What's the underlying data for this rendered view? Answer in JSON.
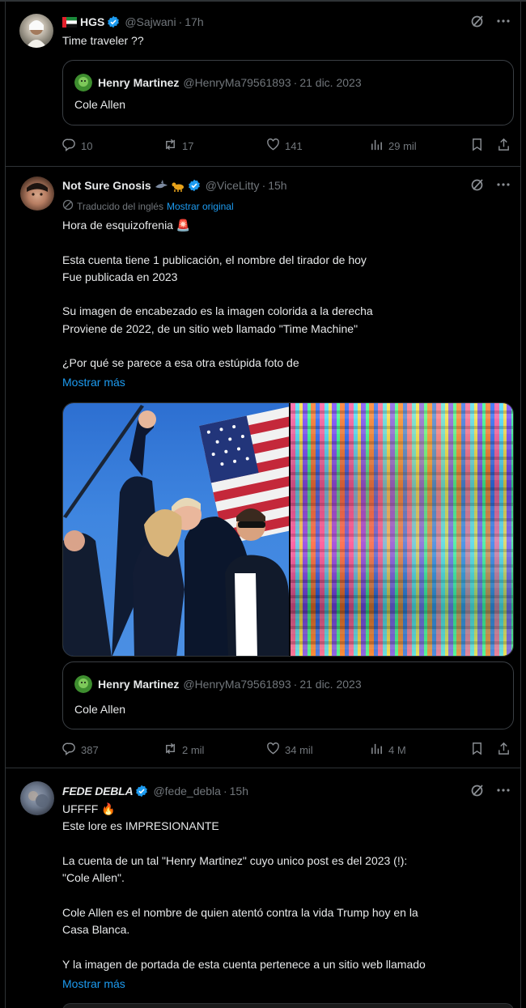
{
  "tweets": [
    {
      "name": "HGS",
      "handle": "@Sajwani",
      "time": "17h",
      "text": "Time traveler ??",
      "quote": {
        "name": "Henry Martinez",
        "handle": "@HenryMa79561893",
        "date": "21 dic. 2023",
        "text": "Cole Allen"
      },
      "stats": {
        "replies": "10",
        "reposts": "17",
        "likes": "141",
        "views": "29 mil"
      }
    },
    {
      "name": "Not Sure Gnosis",
      "handle": "@ViceLitty",
      "time": "15h",
      "translated_label": "Traducido del inglés",
      "show_original": "Mostrar original",
      "text": "Hora de esquizofrenia 🚨\n\nEsta cuenta tiene 1 publicación, el nombre del tirador de hoy\nFue publicada en 2023\n\nSu imagen de encabezado es la imagen colorida a la derecha\nProviene de 2022, de un sitio web llamado \"Time Machine\"\n\n¿Por qué se parece a esa otra estúpida foto de",
      "show_more": "Mostrar más",
      "quote": {
        "name": "Henry Martinez",
        "handle": "@HenryMa79561893",
        "date": "21 dic. 2023",
        "text": "Cole Allen"
      },
      "stats": {
        "replies": "387",
        "reposts": "2 mil",
        "likes": "34 mil",
        "views": "4 M"
      }
    },
    {
      "name": "FEDE DEBLA",
      "handle": "@fede_debla",
      "time": "15h",
      "text": "UFFFF 🔥\nEste lore es IMPRESIONANTE\n\nLa cuenta de un tal \"Henry Martinez\" cuyo unico post es del 2023 (!):\n\"Cole Allen\".\n\nCole Allen es el nombre de quien atentó contra la vida Trump hoy en la\nCasa Blanca.\n\nY la imagen de portada de esta cuenta pertenece a un sitio web llamado",
      "show_more": "Mostrar más"
    }
  ],
  "colors": {
    "accent": "#1d9bf0",
    "muted": "#71767b",
    "border": "#2f3336",
    "bg": "#000000"
  },
  "icons": [
    "verified-badge-icon",
    "grok-icon",
    "more-icon",
    "reply-icon",
    "repost-icon",
    "like-icon",
    "views-icon",
    "bookmark-icon",
    "share-icon",
    "translate-icon"
  ]
}
